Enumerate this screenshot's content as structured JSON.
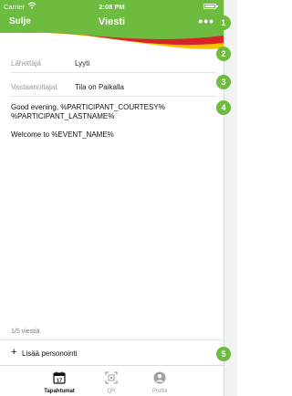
{
  "status_bar": {
    "carrier": "Carrier",
    "time": "2:08 PM"
  },
  "nav": {
    "close_label": "Sulje",
    "title": "Viesti",
    "more_label": "•••"
  },
  "fields": [
    {
      "label": "Lähettäjä",
      "value": "Lyyti"
    },
    {
      "label": "Vastaanottajat",
      "value": "Tila on Paikalla"
    }
  ],
  "message": {
    "line1": "Good evening, %PARTICIPANT_COURTESY% %PARTICIPANT_LASTNAME%",
    "line2": "Welcome to %EVENT_NAME%"
  },
  "counter": "1/5 viestiä",
  "add_personalization": {
    "icon": "plus-icon",
    "label": "Lisää personointi"
  },
  "tabs": [
    {
      "label": "Tapahtumat",
      "icon": "calendar-icon",
      "value": "17",
      "active": true
    },
    {
      "label": "QR",
      "icon": "qr-icon",
      "active": false
    },
    {
      "label": "Profiili",
      "icon": "profile-icon",
      "active": false
    }
  ],
  "markers": [
    "1",
    "2",
    "3",
    "4",
    "5"
  ],
  "colors": {
    "brand_green": "#6dbb3f",
    "wave_red": "#d8232a",
    "wave_yellow": "#f5c400"
  }
}
